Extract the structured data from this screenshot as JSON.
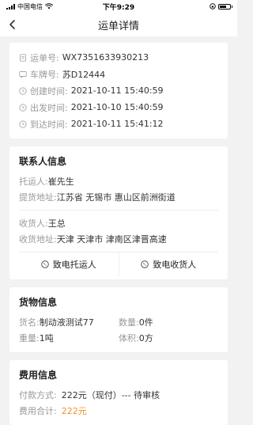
{
  "status_bar": {
    "carrier": "中国电信",
    "time": "下午9:29"
  },
  "nav": {
    "title": "运单详情"
  },
  "waybill": {
    "order_no_label": "运单号:",
    "order_no": "WX7351633930213",
    "plate_label": "车牌号:",
    "plate": "苏D12444",
    "created_label": "创建时间:",
    "created": "2021-10-11 15:40:59",
    "departed_label": "出发时间:",
    "departed": "2021-10-10 15:40:59",
    "arrived_label": "到达时间:",
    "arrived": "2021-10-11 15:41:12"
  },
  "contacts": {
    "title": "联系人信息",
    "shipper_label": "托运人:",
    "shipper": "崔先生",
    "pickup_label": "提货地址:",
    "pickup": "江苏省 无锡市 惠山区前洲街道",
    "receiver_label": "收货人:",
    "receiver": "王总",
    "delivery_label": "收货地址:",
    "delivery": "天津 天津市 津南区津晋高速",
    "call_shipper": "致电托运人",
    "call_receiver": "致电收货人"
  },
  "goods": {
    "title": "货物信息",
    "name_label": "货名:",
    "name": "制动液测试77",
    "qty_label": "数量:",
    "qty": "0件",
    "weight_label": "重量:",
    "weight": "1吨",
    "volume_label": "体积:",
    "volume": "0方"
  },
  "fees": {
    "title": "费用信息",
    "payment_label": "付款方式:",
    "payment": "222元（现付）--- 待审核",
    "total_label": "费用合计:",
    "total": "222元"
  },
  "colors": {
    "accent": "#f0922f"
  }
}
